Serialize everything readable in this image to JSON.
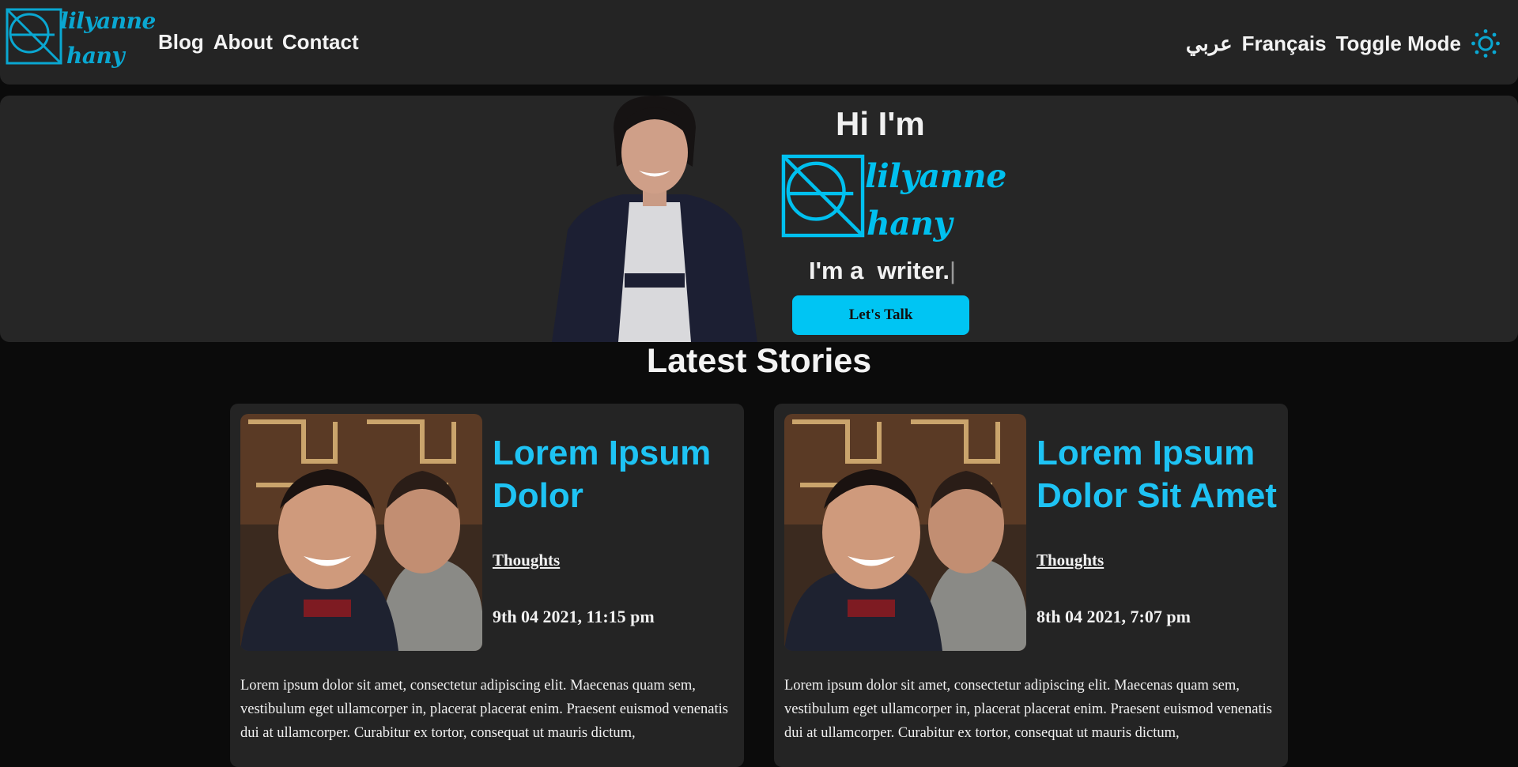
{
  "brand": {
    "line1": "lilyanne",
    "line2": "hany",
    "color": "#0aa7d1"
  },
  "nav": {
    "links": [
      "Blog",
      "About",
      "Contact"
    ],
    "arabic": "عربي",
    "french": "Français",
    "toggle": "Toggle Mode",
    "toggle_icon": "sun-icon"
  },
  "hero": {
    "greeting": "Hi I'm",
    "tagline_prefix": "I'm a",
    "tagline_word": "writer.",
    "cursor": "|",
    "cta": "Let's Talk",
    "accent": "#00c5f3"
  },
  "section": {
    "title": "Latest Stories"
  },
  "stories": [
    {
      "title": "Lorem Ipsum Dolor",
      "category": "Thoughts",
      "date": "9th 04 2021, 11:15 pm",
      "excerpt": "Lorem ipsum dolor sit amet, consectetur adipiscing elit. Maecenas quam sem, vestibulum eget ullamcorper in, placerat placerat enim. Praesent euismod venenatis dui at ullamcorper. Curabitur ex tortor, consequat ut mauris dictum,"
    },
    {
      "title": "Lorem Ipsum Dolor Sit Amet",
      "category": "Thoughts",
      "date": "8th 04 2021, 7:07 pm",
      "excerpt": "Lorem ipsum dolor sit amet, consectetur adipiscing elit. Maecenas quam sem, vestibulum eget ullamcorper in, placerat placerat enim. Praesent euismod venenatis dui at ullamcorper. Curabitur ex tortor, consequat ut mauris dictum,"
    }
  ]
}
